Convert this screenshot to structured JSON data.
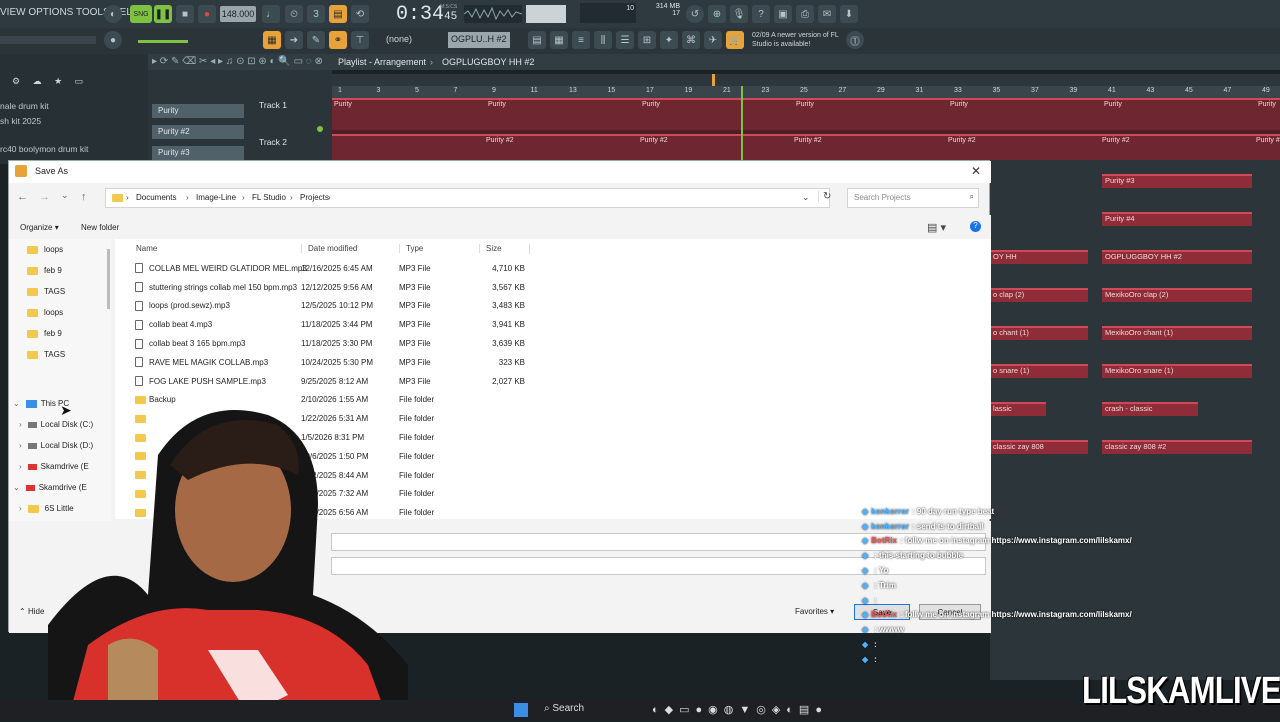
{
  "fl": {
    "menu": "VIEW OPTIONS TOOLS HELP",
    "tempo": "148.000",
    "time_main": "0:34",
    "time_sub": "45",
    "time_cs": "M:S:CS",
    "cpu_value": "10",
    "mem_value": "314 MB",
    "mem_sub": "17",
    "pattern_none": "(none)",
    "pattern_name": "OGPLU..H #2",
    "notice": "02/09  A newer version of FL Studio is available!",
    "playlist_title": "Playlist - Arrangement",
    "playlist_pattern": "OGPLUGGBOY HH #2",
    "browser_items": [
      "nale drum kit",
      "sh kit 2025",
      "rc40 boolymon drum kit"
    ],
    "track_labels": [
      "Track 1",
      "Track 2"
    ],
    "channel_labels": [
      "Purity",
      "Purity #2",
      "Purity #3"
    ],
    "ruler_numbers": [
      "1",
      "3",
      "5",
      "7",
      "9",
      "11",
      "13",
      "15",
      "17",
      "19",
      "21",
      "23",
      "25",
      "27",
      "29",
      "31",
      "33",
      "35",
      "37",
      "39",
      "41",
      "43",
      "45",
      "47",
      "49"
    ],
    "right_clips": [
      "Purity #3",
      "Purity #4",
      "OGPLUGGBOY HH #2",
      "MexikoOro clap (2)",
      "MexikoOro chant (1)",
      "MexikoOro snare (1)",
      "crash - classic",
      "classic zay 808 #2"
    ],
    "left_right_clips": [
      "OY HH",
      "o clap (2)",
      "o chant (1)",
      "o snare (1)",
      "lassic",
      "classic zay 808"
    ]
  },
  "dialog": {
    "title": "Save As",
    "breadcrumb": [
      "Documents",
      "Image-Line",
      "FL Studio",
      "Projects"
    ],
    "search_placeholder": "Search Projects",
    "organize": "Organize",
    "new_folder": "New folder",
    "nav": [
      "loops",
      "feb 9",
      "TAGS",
      "loops",
      "feb 9",
      "TAGS"
    ],
    "this_pc": "This PC",
    "drives": [
      "Local Disk (C:)",
      "Local Disk (D:)",
      "Skamdrive (E",
      "Skamdrive (E",
      "6S Little"
    ],
    "columns": {
      "name": "Name",
      "date": "Date modified",
      "type": "Type",
      "size": "Size"
    },
    "files": [
      {
        "name": "COLLAB MEL WEIRD GLATIDOR MEL.mp3",
        "date": "12/16/2025 6:45 AM",
        "type": "MP3 File",
        "size": "4,710 KB"
      },
      {
        "name": "stuttering strings collab mel 150 bpm.mp3",
        "date": "12/12/2025 9:56 AM",
        "type": "MP3 File",
        "size": "3,567 KB"
      },
      {
        "name": "loops (prod.sewz).mp3",
        "date": "12/5/2025 10:12 PM",
        "type": "MP3 File",
        "size": "3,483 KB"
      },
      {
        "name": "collab beat 4.mp3",
        "date": "11/18/2025 3:44 PM",
        "type": "MP3 File",
        "size": "3,941 KB"
      },
      {
        "name": "collab beat 3 165 bpm.mp3",
        "date": "11/18/2025 3:30 PM",
        "type": "MP3 File",
        "size": "3,639 KB"
      },
      {
        "name": "RAVE MEL MAGIK COLLAB.mp3",
        "date": "10/24/2025 5:30 PM",
        "type": "MP3 File",
        "size": "323 KB"
      },
      {
        "name": "FOG LAKE PUSH SAMPLE.mp3",
        "date": "9/25/2025 8:12 AM",
        "type": "MP3 File",
        "size": "2,027 KB"
      },
      {
        "name": "Backup",
        "date": "2/10/2026 1:55 AM",
        "type": "File folder",
        "size": ""
      },
      {
        "name": "",
        "date": "1/22/2026 5:31 AM",
        "type": "File folder",
        "size": ""
      },
      {
        "name": "",
        "date": "1/5/2026 8:31 PM",
        "type": "File folder",
        "size": ""
      },
      {
        "name": "",
        "date": "10/6/2025 1:50 PM",
        "type": "File folder",
        "size": ""
      },
      {
        "name": "",
        "date": "9/22/2025 8:44 AM",
        "type": "File folder",
        "size": ""
      },
      {
        "name": "",
        "date": "9/21/2025 7:32 AM",
        "type": "File folder",
        "size": ""
      },
      {
        "name": "",
        "date": "9/21/2025 6:56 AM",
        "type": "File folder",
        "size": ""
      }
    ],
    "hide_folders": "Hide",
    "favorites": "Favorites",
    "save": "Save",
    "cancel": "Cancel"
  },
  "chat": [
    {
      "user": "konkorror",
      "msg": ": 90 day run type beat",
      "color": "#4db1ff"
    },
    {
      "user": "konkorror",
      "msg": ": send ts to dirtball",
      "color": "#4db1ff"
    },
    {
      "user": "BotRix",
      "msg": ": follw me on instagram https://www.instagram.com/lilskamx/",
      "color": "#ff4b4b"
    },
    {
      "user": "",
      "msg": ": this starting to bubble",
      "color": "#9b59ff"
    },
    {
      "user": "",
      "msg": ": Yo",
      "color": "#9b59ff"
    },
    {
      "user": "",
      "msg": ": Trim",
      "color": "#9b59ff"
    },
    {
      "user": "",
      "msg": ":",
      "color": "#9b59ff"
    },
    {
      "user": "BotRix",
      "msg": ": follw me on instagram https://www.instagram.com/lilskamx/",
      "color": "#ff4b4b"
    },
    {
      "user": "",
      "msg": ": wwww",
      "color": "#ff4b4b"
    },
    {
      "user": "",
      "msg": ":",
      "color": "#ff4b4b"
    },
    {
      "user": "",
      "msg": ":",
      "color": "#ff4b4b"
    }
  ],
  "taskbar": {
    "search": "Search"
  },
  "watermark": "LILSKAMLIVE",
  "colors": {
    "fl_bg": "#1b2226",
    "clip": "#8e2d37",
    "clip_border": "#d1485a",
    "accent_orange": "#e8a23a",
    "playhead": "#7fc241"
  }
}
